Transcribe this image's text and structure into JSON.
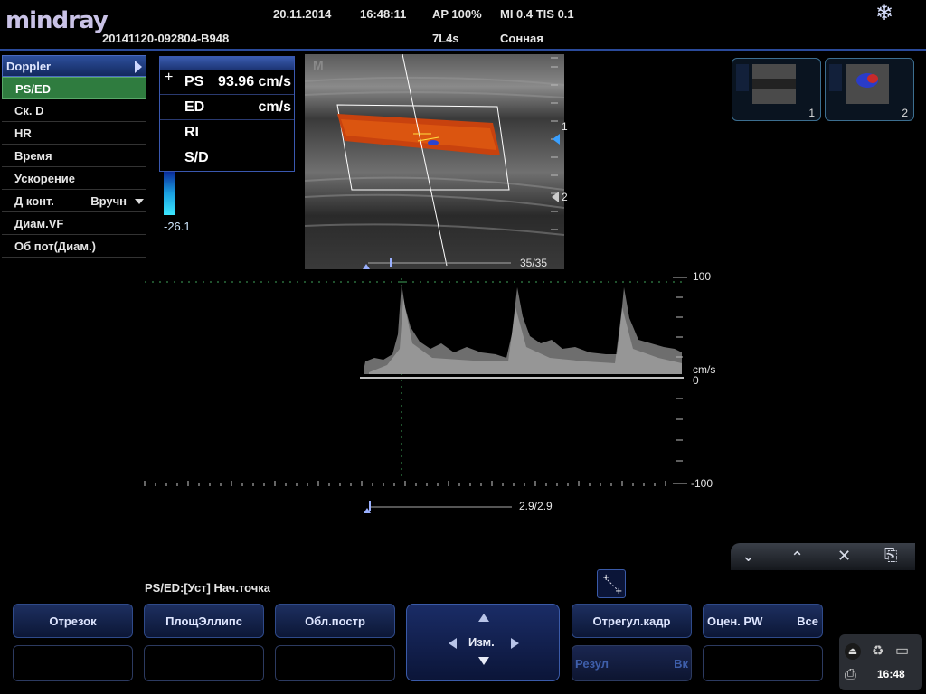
{
  "header": {
    "logo": "mindray",
    "date": "20.11.2014",
    "time": "16:48:11",
    "ap": "AP  100%",
    "mi_tis": "MI 0.4 TIS 0.1",
    "exam_id": "20141120-092804-B948",
    "probe": "7L4s",
    "preset": "Сонная",
    "freeze_icon": "snowflake-icon"
  },
  "menu": {
    "title": "Doppler",
    "items": [
      {
        "label": "PS/ED",
        "selected": true
      },
      {
        "label": "Ск. D"
      },
      {
        "label": "HR"
      },
      {
        "label": "Время"
      },
      {
        "label": "Ускорение"
      },
      {
        "label": "Д конт.",
        "value": "Вручн"
      },
      {
        "label": "Диам.VF"
      },
      {
        "label": "Об пот(Диам.)"
      }
    ]
  },
  "results": {
    "cross": "+",
    "rows": [
      {
        "key": "PS",
        "value": "93.96 cm/s"
      },
      {
        "key": "ED",
        "value": "cm/s"
      },
      {
        "key": "RI",
        "value": ""
      },
      {
        "key": "S/D",
        "value": ""
      }
    ]
  },
  "color_scale": {
    "min": "-26.1"
  },
  "image": {
    "frame_counter": "35/35",
    "depth_marks": [
      "1",
      "2"
    ],
    "m_mark": "M"
  },
  "spectrum": {
    "scale_top": "100",
    "unit": "cm/s",
    "zero": "0",
    "scale_bottom": "-100",
    "counter": "2.9/2.9"
  },
  "thumbnails": [
    {
      "label": "1"
    },
    {
      "label": "2"
    }
  ],
  "status_line": "PS/ED:[Уст] Нач.точка",
  "buttons": {
    "segment": "Отрезок",
    "area_ellipse": "ПлощЭллипс",
    "trace": "Обл.постр",
    "measure": "Изм.",
    "adjust_frame": "Отрегул.кадр",
    "eval_pw": "Оцен. PW",
    "eval_pw_value": "Все",
    "result": "Резул",
    "result_value": "Вк"
  },
  "tray": {
    "time": "16:48"
  },
  "colors": {
    "accent": "#2a4a9a",
    "selected": "#2f7c3f",
    "button_bg": "#14234f"
  }
}
